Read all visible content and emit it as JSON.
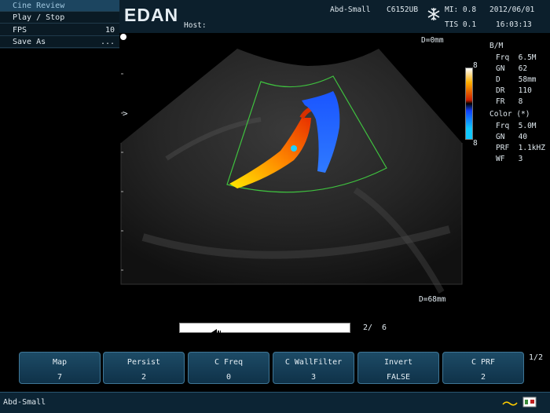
{
  "cine_menu": {
    "items": [
      {
        "label": "Cine Review",
        "value": ""
      },
      {
        "label": "Play / Stop",
        "value": ""
      },
      {
        "label": "FPS",
        "value": "10"
      },
      {
        "label": "Save As",
        "value": "..."
      }
    ]
  },
  "header": {
    "logo": "EDAN",
    "host_label": "Host:",
    "exam": "Abd-Small",
    "probe": "C6152UB",
    "mi": "MI: 0.8",
    "tis": "TIS 0.1",
    "date": "2012/06/01",
    "time": "16:03:13"
  },
  "image": {
    "depth_top": "D=0mm",
    "depth_bottom": "D=68mm",
    "orientation_marker": ">"
  },
  "color_scale": {
    "top": "8",
    "bottom": "8"
  },
  "params": {
    "bm_title": "B/M",
    "bm": [
      {
        "k": "Frq",
        "v": "6.5M"
      },
      {
        "k": "GN",
        "v": "62"
      },
      {
        "k": "D",
        "v": "58mm"
      },
      {
        "k": "DR",
        "v": "110"
      },
      {
        "k": "FR",
        "v": "8"
      }
    ],
    "color_title": "Color (*)",
    "color": [
      {
        "k": "Frq",
        "v": "5.0M"
      },
      {
        "k": "GN",
        "v": "40"
      },
      {
        "k": "PRF",
        "v": "1.1kHZ"
      },
      {
        "k": "WF",
        "v": "3"
      }
    ]
  },
  "cine": {
    "frame": "2/",
    "total": "6",
    "progress_fraction": 0.2
  },
  "softkeys": [
    {
      "label": "Map",
      "value": "7"
    },
    {
      "label": "Persist",
      "value": "2"
    },
    {
      "label": "C Freq",
      "value": "0"
    },
    {
      "label": "C WallFilter",
      "value": "3"
    },
    {
      "label": "Invert",
      "value": "FALSE"
    },
    {
      "label": "C PRF",
      "value": "2"
    }
  ],
  "page_indicator": "1/2",
  "status": {
    "exam": "Abd-Small"
  },
  "colors": {
    "accent": "#1d4b66",
    "roi_box": "#3fc23f",
    "flow_red": "#ff6a00",
    "flow_blue": "#1e64ff"
  }
}
